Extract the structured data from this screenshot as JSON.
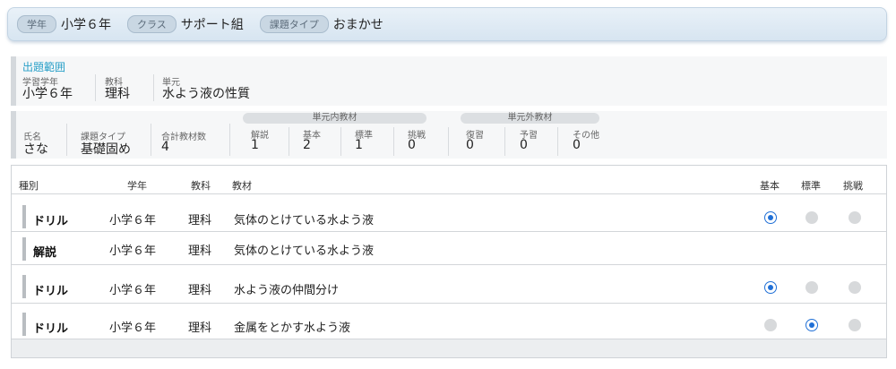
{
  "header": {
    "grade_label": "学年",
    "grade_value": "小学６年",
    "class_label": "クラス",
    "class_value": "サポート組",
    "type_label": "課題タイプ",
    "type_value": "おまかせ"
  },
  "scope": {
    "title": "出題範囲",
    "grade_caption": "学習学年",
    "grade_value": "小学６年",
    "subject_caption": "教科",
    "subject_value": "理科",
    "unit_caption": "単元",
    "unit_value": "水よう液の性質"
  },
  "summary": {
    "name_caption": "氏名",
    "name_value": "さな",
    "type_caption": "課題タイプ",
    "type_value": "基礎固め",
    "total_caption": "合計教材数",
    "total_value": "4",
    "inner_group": "単元内教材",
    "outer_group": "単元外教材",
    "cols": [
      {
        "caption": "解説",
        "value": "1"
      },
      {
        "caption": "基本",
        "value": "2"
      },
      {
        "caption": "標準",
        "value": "1"
      },
      {
        "caption": "挑戦",
        "value": "0"
      },
      {
        "caption": "復習",
        "value": "0"
      },
      {
        "caption": "予習",
        "value": "0"
      },
      {
        "caption": "その他",
        "value": "0"
      }
    ]
  },
  "table": {
    "headers": {
      "kind": "種別",
      "grade": "学年",
      "subject": "教科",
      "material": "教材",
      "basic": "基本",
      "standard": "標準",
      "challenge": "挑戦"
    },
    "rows": [
      {
        "kind": "ドリル",
        "grade": "小学６年",
        "subject": "理科",
        "material": "気体のとけている水よう液",
        "level": "basic"
      },
      {
        "kind": "解説",
        "grade": "小学６年",
        "subject": "理科",
        "material": "気体のとけている水よう液",
        "level": ""
      },
      {
        "kind": "ドリル",
        "grade": "小学６年",
        "subject": "理科",
        "material": "水よう液の仲間分け",
        "level": "basic"
      },
      {
        "kind": "ドリル",
        "grade": "小学６年",
        "subject": "理科",
        "material": "金属をとかす水よう液",
        "level": "standard"
      }
    ]
  },
  "colors": {
    "accent": "#2aa0c8",
    "radio_selected": "#1f6fd6"
  }
}
